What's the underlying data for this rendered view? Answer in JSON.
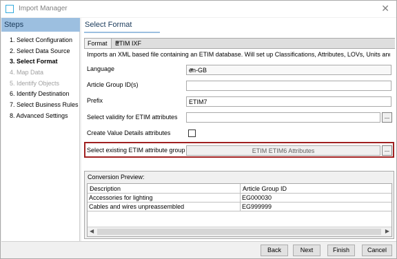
{
  "window": {
    "title": "Import Manager"
  },
  "steps": {
    "header": "Steps",
    "items": [
      {
        "label": "1. Select Configuration",
        "state": "normal"
      },
      {
        "label": "2. Select Data Source",
        "state": "normal"
      },
      {
        "label": "3. Select Format",
        "state": "active"
      },
      {
        "label": "4. Map Data",
        "state": "disabled"
      },
      {
        "label": "5. Identify Objects",
        "state": "disabled"
      },
      {
        "label": "6. Identify Destination",
        "state": "normal"
      },
      {
        "label": "7. Select Business Rules",
        "state": "normal"
      },
      {
        "label": "8. Advanced Settings",
        "state": "normal"
      }
    ]
  },
  "main": {
    "title": "Select Format",
    "format": {
      "label": "Format",
      "value": "ETIM IXF"
    },
    "description": "Imports an XML based file containing an ETIM database. Will set up Classifications, Attributes, LOVs, Units and Obj...",
    "fields": {
      "language": {
        "label": "Language",
        "value": "en-GB"
      },
      "article_group": {
        "label": "Article Group ID(s)",
        "value": ""
      },
      "prefix": {
        "label": "Prefix",
        "value": "ETIM7"
      },
      "validity": {
        "label": "Select validity for ETIM attributes",
        "value": ""
      },
      "value_details": {
        "label": "Create Value Details attributes",
        "checked": false
      },
      "attribute_group": {
        "label": "Select existing ETIM attribute group",
        "value": "ETIM ETIM6 Attributes"
      }
    },
    "browse_label": "...",
    "preview": {
      "label": "Conversion Preview:",
      "columns": [
        "Description",
        "Article Group ID"
      ],
      "rows": [
        [
          "Accessories for lighting",
          "EG000030"
        ],
        [
          "Cables and wires unpreassembled",
          "EG999999"
        ]
      ]
    }
  },
  "buttons": {
    "back": "Back",
    "next": "Next",
    "finish": "Finish",
    "cancel": "Cancel"
  },
  "colors": {
    "accent": "#9cbfe0",
    "highlight_border": "#a02020"
  },
  "icons": {
    "window": "window-icon",
    "close": "close-icon",
    "dropdown": "chevron-down-icon",
    "scroll_left": "arrow-left-icon",
    "scroll_right": "arrow-right-icon",
    "sort": "chevron-right-icon"
  }
}
